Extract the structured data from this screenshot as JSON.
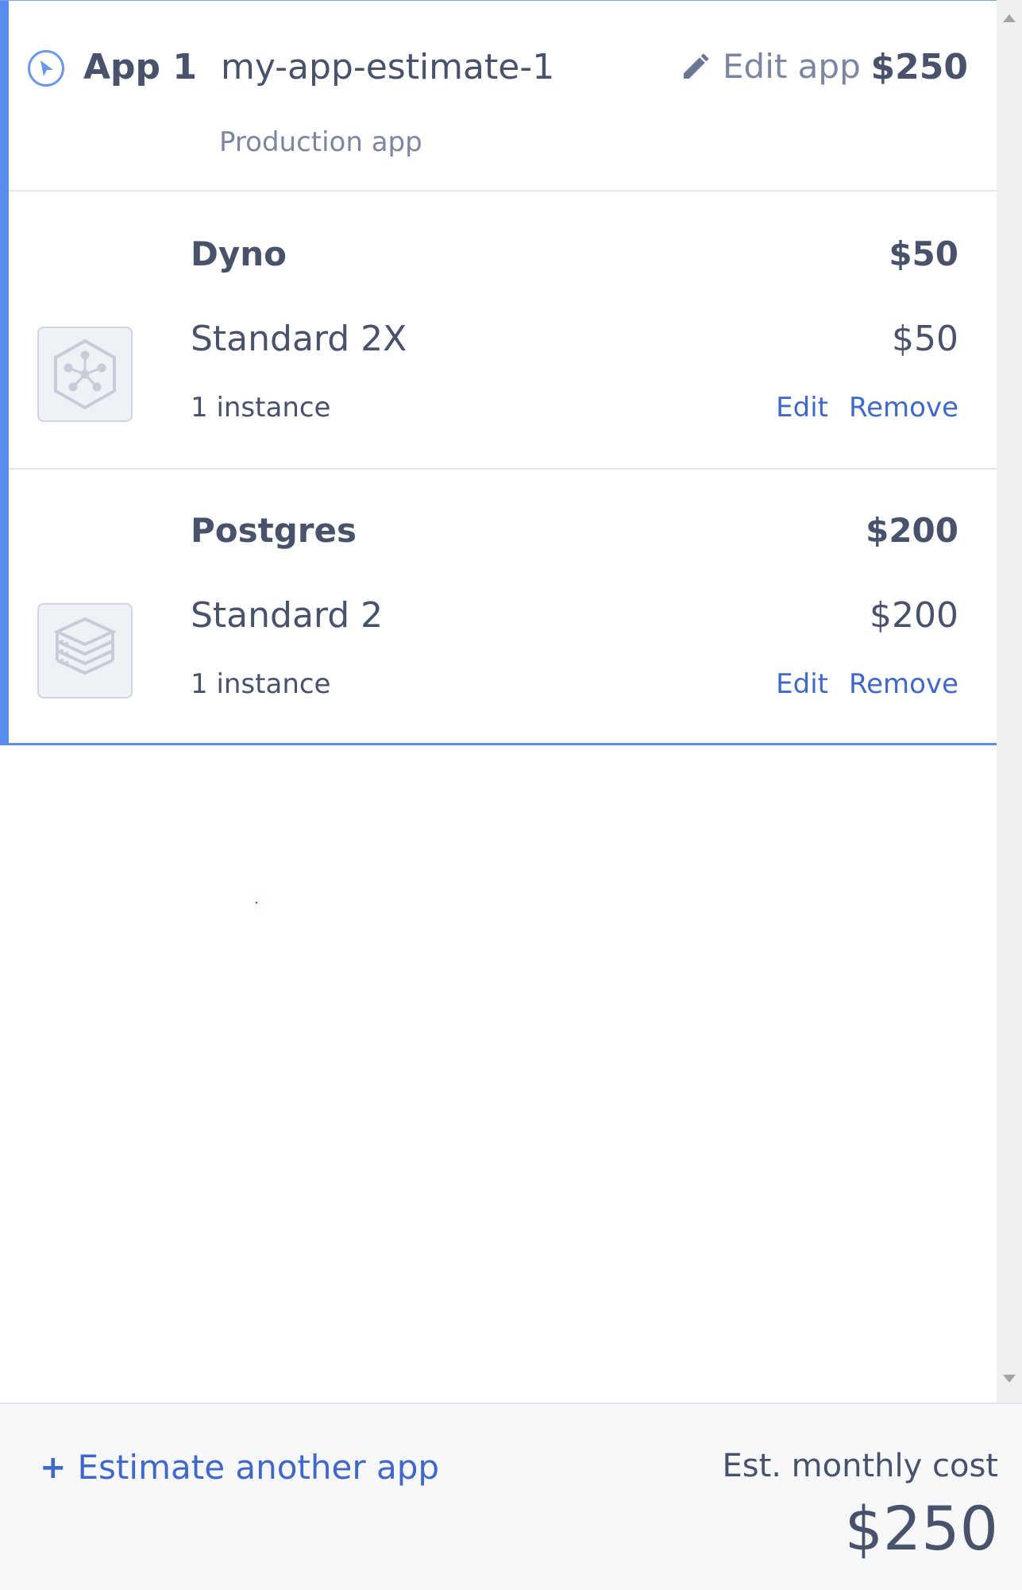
{
  "app": {
    "number_label": "App 1",
    "name": "my-app-estimate-1",
    "subtitle": "Production app",
    "edit_label": "Edit app",
    "total": "$250",
    "icon": "compass-cursor-icon",
    "accent_color": "#5a8cf0"
  },
  "addons": [
    {
      "category": "Dyno",
      "category_price": "$50",
      "plan": "Standard 2X",
      "plan_price": "$50",
      "quantity": "1 instance",
      "edit_label": "Edit",
      "remove_label": "Remove",
      "icon": "dyno-hexagon-icon"
    },
    {
      "category": "Postgres",
      "category_price": "$200",
      "plan": "Standard 2",
      "plan_price": "$200",
      "quantity": "1 instance",
      "edit_label": "Edit",
      "remove_label": "Remove",
      "icon": "database-stack-icon"
    }
  ],
  "footer": {
    "add_app_label": "Estimate another app",
    "plus_icon": "+",
    "est_label": "Est. monthly cost",
    "est_total": "$250",
    "link_color": "#4068c8"
  }
}
